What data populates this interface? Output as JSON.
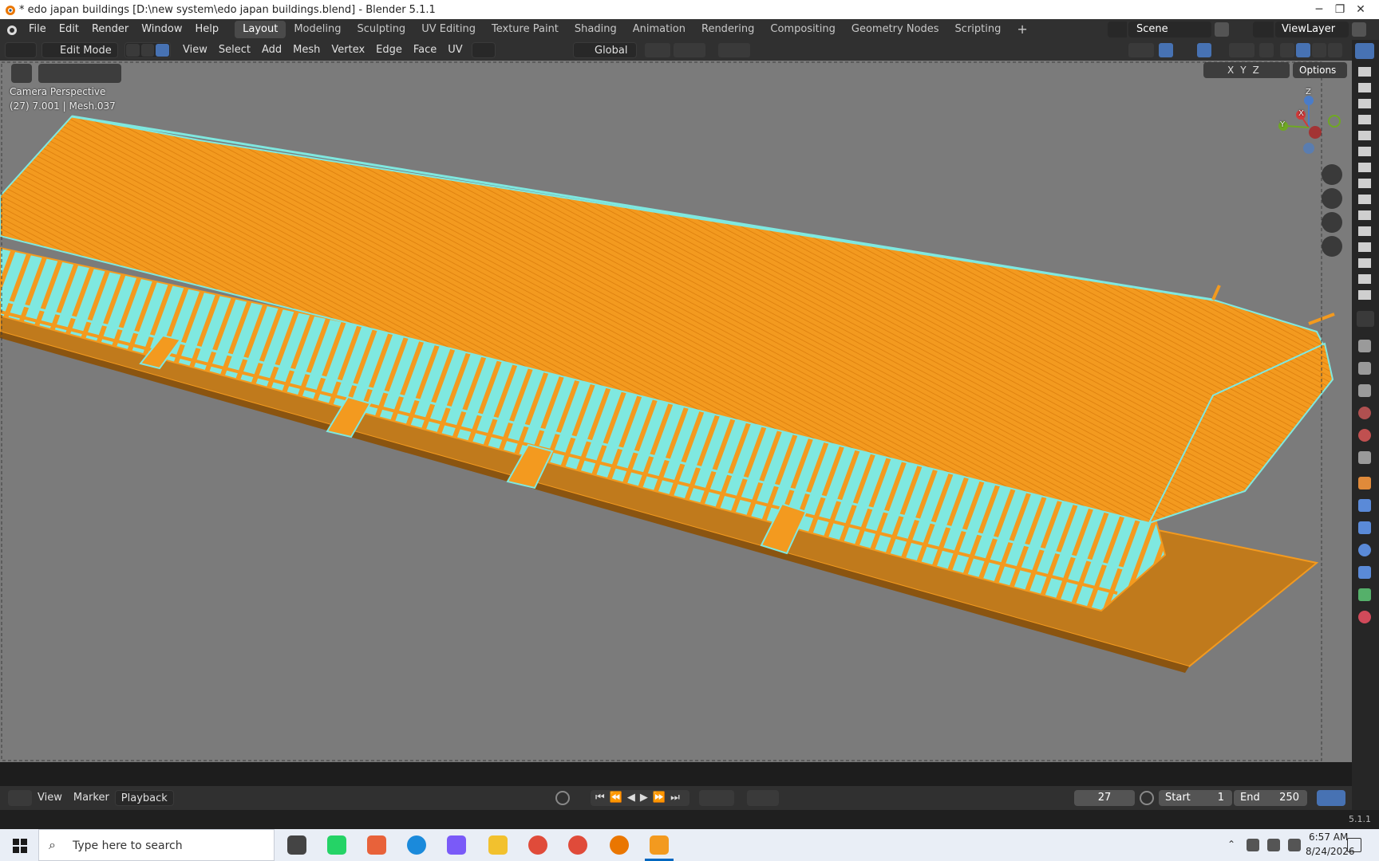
{
  "window": {
    "title": "* edo japan buildings [D:\\new system\\edo japan buildings.blend] - Blender 5.1.1",
    "minimize_glyph": "─",
    "maximize_glyph": "❐",
    "close_glyph": "✕"
  },
  "menubar": {
    "items": [
      "File",
      "Edit",
      "Render",
      "Window",
      "Help"
    ]
  },
  "workspaces": {
    "tabs": [
      "Layout",
      "Modeling",
      "Sculpting",
      "UV Editing",
      "Texture Paint",
      "Shading",
      "Animation",
      "Rendering",
      "Compositing",
      "Geometry Nodes",
      "Scripting"
    ],
    "active": "Layout",
    "add_glyph": "+"
  },
  "scene": {
    "name": "Scene",
    "view_layer": "ViewLayer"
  },
  "header": {
    "mode": "Edit Mode",
    "menus": [
      "View",
      "Select",
      "Add",
      "Mesh",
      "Vertex",
      "Edge",
      "Face",
      "UV"
    ],
    "orientation": "Global",
    "options_label": "Options",
    "axis_x": "X",
    "axis_y": "Y",
    "axis_z": "Z"
  },
  "viewport": {
    "view_name": "Camera Perspective",
    "object_info": "(27) 7.001 | Mesh.037",
    "gizmo_x": "X",
    "gizmo_y": "Y",
    "gizmo_z": "Z"
  },
  "timeline": {
    "menus": [
      "View",
      "Marker",
      "Playback"
    ],
    "current_frame": "27",
    "start_label": "Start",
    "start_value": "1",
    "end_label": "End",
    "end_value": "250"
  },
  "status": {
    "version": "5.1.1"
  },
  "taskbar": {
    "search_placeholder": "Type here to search",
    "time": "6:57 AM",
    "date": "8/24/2026"
  },
  "colors": {
    "selection_orange": "#f39a1f",
    "edge_cyan": "#7fe8e0",
    "viewport_bg": "#7b7b7b",
    "accent_blue": "#4772b3"
  }
}
